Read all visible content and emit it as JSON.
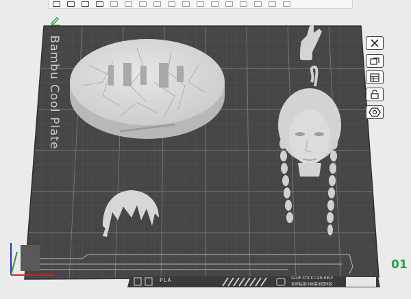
{
  "plate": {
    "label": "Bambu Cool Plate",
    "index": "01",
    "filament": "PLA",
    "note_line1": "GLUE STICK CAN HELP",
    "note_line2": "有效粘接冷板需涂固体胶"
  },
  "side_buttons": [
    {
      "name": "close-plate-button",
      "icon": "close-icon"
    },
    {
      "name": "arrange-button",
      "icon": "arrange-icon"
    },
    {
      "name": "plate-settings-button",
      "icon": "settings-icon"
    },
    {
      "name": "lock-button",
      "icon": "unlock-icon"
    },
    {
      "name": "slice-plate-button",
      "icon": "hexagon-icon"
    }
  ],
  "colors": {
    "plate": "#464646",
    "grid": "#6c6c6c",
    "model": "#d2d2d2",
    "accent_green": "#1fa34a",
    "axis_x": "#d62020",
    "axis_y": "#20a020",
    "axis_z": "#2030d0"
  }
}
